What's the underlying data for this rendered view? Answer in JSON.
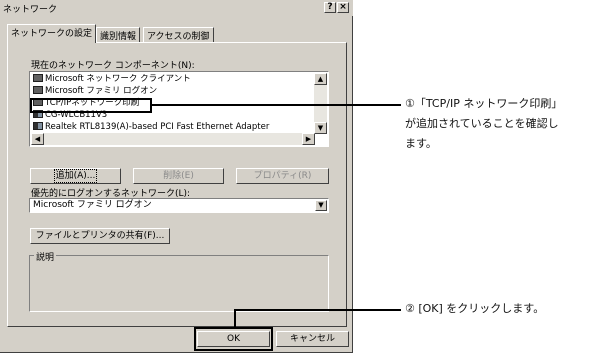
{
  "window": {
    "title": "ネットワーク",
    "help_btn": "?",
    "close_btn": "×"
  },
  "tabs": [
    "ネットワークの設定",
    "識別情報",
    "アクセスの制御"
  ],
  "components": {
    "label": "現在のネットワーク コンポーネント(N):",
    "items": [
      "Microsoft ネットワーク クライアント",
      "Microsoft ファミリ ログオン",
      "TCP/IPネットワーク印刷",
      "CG-WLCB11V3",
      "Realtek RTL8139(A)-based PCI Fast Ethernet Adapter"
    ]
  },
  "buttons": {
    "add": "追加(A)...",
    "remove": "削除(E)",
    "properties": "プロパティ(R)",
    "file_print_sharing": "ファイルとプリンタの共有(F)...",
    "ok": "OK",
    "cancel": "キャンセル"
  },
  "logon": {
    "label": "優先的にログオンするネットワーク(L):",
    "value": "Microsoft ファミリ ログオン"
  },
  "description": {
    "label": "説明"
  },
  "callouts": {
    "one": [
      "①「TCP/IP ネットワーク印刷」",
      "が追加されていることを確認し",
      "ます。"
    ],
    "two": "② [OK] をクリックします。"
  },
  "icons": {
    "scroll_up": "triangle-up-icon",
    "scroll_down": "triangle-down-icon",
    "scroll_left": "triangle-left-icon",
    "scroll_right": "triangle-right-icon",
    "component": "network-component-icon"
  }
}
